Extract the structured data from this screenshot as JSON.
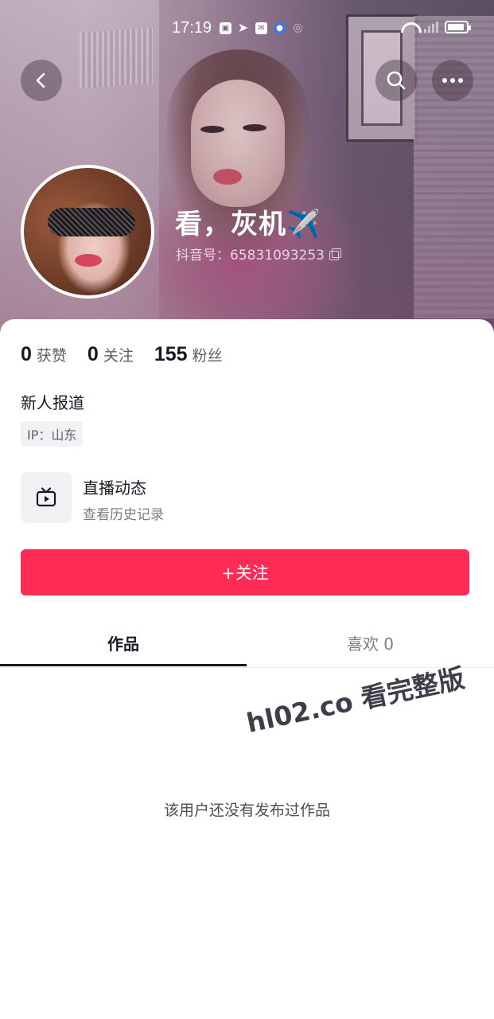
{
  "status_bar": {
    "time": "17:19"
  },
  "header": {
    "back_icon": "chevron-left-icon",
    "search_icon": "search-icon",
    "more_icon": "more-horizontal-icon"
  },
  "profile": {
    "name": "看，灰机✈️",
    "account": "抖音号：65831093253",
    "stats": [
      {
        "num": "0",
        "label": "获赞"
      },
      {
        "num": "0",
        "label": "关注"
      },
      {
        "num": "155",
        "label": "粉丝"
      }
    ],
    "bio": "新人报道",
    "ip": "IP：山东"
  },
  "live": {
    "title": "直播动态",
    "subtitle": "查看历史记录",
    "icon": "tv-icon"
  },
  "follow_button": {
    "label": "+关注"
  },
  "tabs": [
    {
      "label": "作品"
    },
    {
      "label": "喜欢 0"
    }
  ],
  "watermark": "hl02.co 看完整版",
  "empty_state": "该用户还没有发布过作品",
  "colors": {
    "accent": "#fe2c55",
    "text": "#161823"
  }
}
